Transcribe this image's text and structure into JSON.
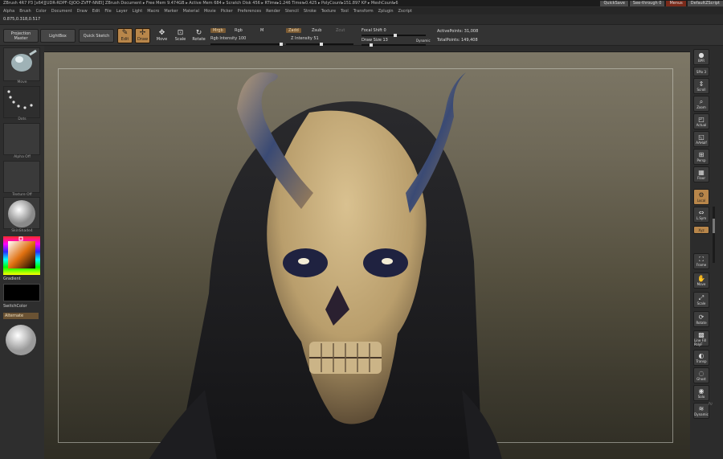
{
  "titlebar": {
    "text": "ZBrush 4R7 P3 [x64][UDR-RDPF-QJOO-ZVFF-NNEI]    ZBrush Document    ▸ Free Mem 9.474GB ▸ Active Mem 684 ▸ Scratch Disk 456 ▸ RTime▸1.246 Timer▸0.425 ▸ PolyCount▸151.897 KP ▸ MeshCount▸6",
    "quicksave": "QuickSave",
    "seethrough": "See-through  0",
    "menus": "Menus",
    "script": "DefaultZScript"
  },
  "menubar": [
    "Alpha",
    "Brush",
    "Color",
    "Document",
    "Draw",
    "Edit",
    "File",
    "Layer",
    "Light",
    "Macro",
    "Marker",
    "Material",
    "Movie",
    "Picker",
    "Preferences",
    "Render",
    "Stencil",
    "Stroke",
    "Texture",
    "Tool",
    "Transform",
    "Zplugin",
    "Zscript"
  ],
  "stats": "0.875,0.318,0.517",
  "toolbar": {
    "projection_master": "Projection Master",
    "lightbox": "LightBox",
    "quick_sketch": "Quick Sketch",
    "edit": "Edit",
    "draw": "Draw",
    "move": "Move",
    "scale": "Scale",
    "rotate": "Rotate",
    "mrgb": "Mrgb",
    "rgb": "Rgb",
    "m": "M",
    "rgb_intensity": "Rgb Intensity 100",
    "zadd": "Zadd",
    "zsub": "Zsub",
    "zcut": "Zcut",
    "z_intensity": "Z Intensity 51",
    "focal_shift": "Focal Shift 0",
    "draw_size": "Draw Size 13",
    "dynamic": "Dynamic",
    "active_points": "ActivePoints: 31,008",
    "total_points": "TotalPoints: 149,408"
  },
  "leftpanel": {
    "brush": "Move",
    "stroke": "Dots",
    "alpha": "Alpha Off",
    "texture": "Texture Off",
    "material": "SkinShade4",
    "gradient": "Gradient",
    "switchcolor": "SwitchColor",
    "alternate": "Alternate"
  },
  "rightpanel": [
    "BPR",
    "SPix 3",
    "Scroll",
    "Zoom",
    "Actual",
    "AAHalf",
    "Persp",
    "Floor",
    "Local",
    "L.Sym",
    "Xyz",
    "Frame",
    "Move",
    "Scale",
    "Rotate",
    "Line Fill PolyF",
    "Transp",
    "Ghost",
    "Solo",
    "Dynamic"
  ],
  "colors": {
    "accent": "#b8864a",
    "swatch_main": "#e07010"
  }
}
